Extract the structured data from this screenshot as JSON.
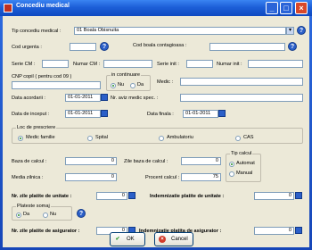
{
  "window": {
    "title": "Concediu medical"
  },
  "fields": {
    "tip_concediu": {
      "label": "Tip concediu medical :",
      "value": "01 Boala Obisnuita"
    },
    "cod_urgenta": {
      "label": "Cod urgenta :",
      "value": ""
    },
    "cod_boala": {
      "label": "Cod boala contagioasa :",
      "value": ""
    },
    "serie_cm": {
      "label": "Serie CM :",
      "value": ""
    },
    "numar_cm": {
      "label": "Numar CM :",
      "value": ""
    },
    "serie_init": {
      "label": "Serie init :",
      "value": ""
    },
    "numar_init": {
      "label": "Numar init :",
      "value": ""
    },
    "cnp_copil": {
      "label": "CNP copil ( pentru cod 09 )",
      "value": ""
    },
    "medic": {
      "label": "Medic :",
      "value": ""
    },
    "data_acordarii": {
      "label": "Data acordarii :",
      "value": "01-01-2011"
    },
    "nr_aviz": {
      "label": "Nr. aviz medic spec. :",
      "value": ""
    },
    "data_inceput": {
      "label": "Data de inceput :",
      "value": "01-01-2011"
    },
    "data_finala": {
      "label": "Data finala :",
      "value": "01-01-2011"
    },
    "baza_calcul": {
      "label": "Baza de calcul :",
      "value": "0"
    },
    "zile_baza": {
      "label": "Zile baza de calcul :",
      "value": "0"
    },
    "media_zilnica": {
      "label": "Media zilnica :",
      "value": "0"
    },
    "procent_calcul": {
      "label": "Procent calcul :",
      "value": "75"
    },
    "nr_zile_unitate": {
      "label": "Nr. zile platite de unitate :",
      "value": "0"
    },
    "indemnizatie_unitate": {
      "label": "Indemnizatie platite de unitate :",
      "value": "0"
    },
    "nr_zile_asigurator": {
      "label": "Nr. zile platite de asigurator :",
      "value": "0"
    },
    "indemnizatie_asigurator": {
      "label": "Indemnizatie platita de asigurator :",
      "value": "0"
    }
  },
  "in_continuare": {
    "label": "in continuare",
    "options": [
      "Nu",
      "Da"
    ],
    "selected": "Nu"
  },
  "loc_prescriere": {
    "label": "Loc de prescriere",
    "options": [
      "Medic familie",
      "Spital",
      "Ambulatoriu",
      "CAS"
    ],
    "selected": "Medic familie"
  },
  "tip_calcul": {
    "label": "Tip calcul",
    "options": [
      "Automat",
      "Manual"
    ],
    "selected": "Automat"
  },
  "plateste_somaj": {
    "label": "Plateste somaj",
    "options": [
      "Da",
      "Nu"
    ],
    "selected": "Da"
  },
  "buttons": {
    "ok": "OK",
    "cancel": "Cancel"
  },
  "icons": {
    "help": "?",
    "dropdown": "▾"
  }
}
